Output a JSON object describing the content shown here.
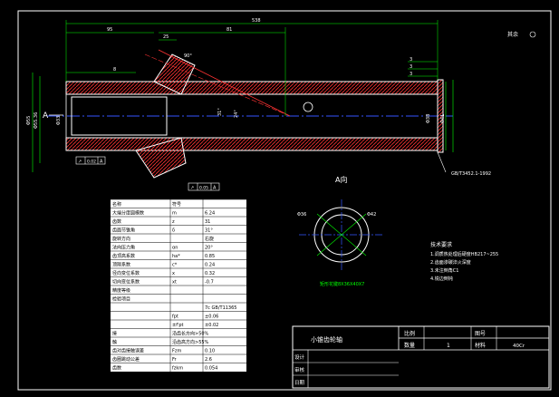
{
  "drawing": {
    "section_label": "A",
    "view_label": "A向",
    "roughness_label": "其余",
    "title": "小锥齿轮轴",
    "spline_label": "矩形花键8X36X40X7",
    "thread_note": "GB/T3452.1-1992",
    "dimensions": {
      "total": "538",
      "d1": "95",
      "d2": "81",
      "d3": "25",
      "d4": "8",
      "d5": "90°",
      "d6": "3",
      "d7": "3",
      "d8": "3",
      "left_dia": "Φ55",
      "left_dia2": "Φ55.36",
      "inner": "Φ33",
      "right1": "Φ41",
      "right2": "Φ38",
      "spline_dia1": "Φ36",
      "spline_dia2": "Φ42",
      "angle1": "31°",
      "angle2": "24°"
    },
    "tolerance_boxes": [
      {
        "sym": "↗",
        "val": "0.02",
        "ref": "A"
      },
      {
        "sym": "↗",
        "val": "0.05",
        "ref": "A"
      }
    ]
  },
  "params_table": {
    "header": [
      "名称",
      "符号"
    ],
    "rows": [
      [
        "大端分度圆模数",
        "m",
        "6.24"
      ],
      [
        "齿数",
        "z",
        "31"
      ],
      [
        "齿面节锥角",
        "δ",
        "31°"
      ],
      [
        "旋转方向",
        "",
        "右旋"
      ],
      [
        "法向压力角",
        "αn",
        "20°"
      ],
      [
        "齿顶高系数",
        "ha*",
        "0.85"
      ],
      [
        "顶隙系数",
        "c*",
        "0.24"
      ],
      [
        "径向变位系数",
        "x",
        "0.32"
      ],
      [
        "切向变位系数",
        "xt",
        "-0.7"
      ],
      [
        "精度等级",
        "",
        ""
      ],
      [
        "检验项目",
        "",
        ""
      ],
      [
        "",
        "",
        "7c GB/T11365"
      ],
      [
        "",
        "fpt",
        "±0.06"
      ],
      [
        "",
        "±f'pt",
        "±0.02"
      ],
      [
        "接",
        "沿齿长方向>50%",
        ""
      ],
      [
        "触",
        "沿齿高方向>55%",
        ""
      ],
      [
        "齿对齿接触误差",
        "Fzm",
        "0.10"
      ],
      [
        "齿圈跳动公差",
        "Fr",
        "2.6"
      ],
      [
        "齿数",
        "fzkm",
        "0.054"
      ]
    ]
  },
  "tech_req": {
    "title": "技术要求",
    "lines": [
      "1.调质热处理后硬度HB217~255",
      "2.齿面渗碳淬火深度",
      "3.未注倒角C1",
      "4.锐边倒钝"
    ]
  },
  "title_block": {
    "title": "小锥齿轮轴",
    "labels": [
      "比例",
      "图号",
      "数量",
      "材料"
    ],
    "quantity": "1",
    "material": "40Cr",
    "rows": [
      "设计",
      "审核",
      "日期"
    ]
  }
}
